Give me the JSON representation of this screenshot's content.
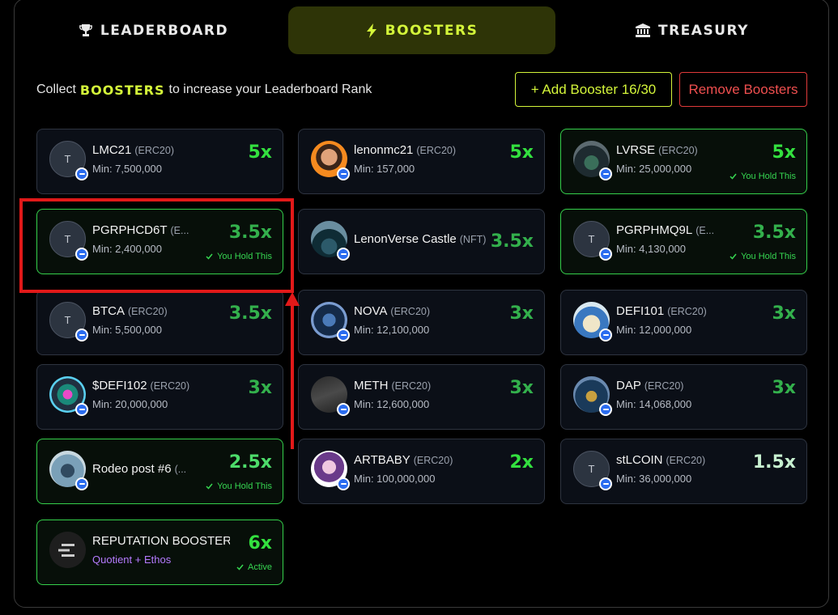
{
  "tabs": [
    {
      "label": "LEADERBOARD",
      "icon": "trophy-icon",
      "active": false
    },
    {
      "label": "BOOSTERS",
      "icon": "lightning-icon",
      "active": true
    },
    {
      "label": "TREASURY",
      "icon": "bank-icon",
      "active": false
    }
  ],
  "headline": {
    "prefix": "Collect",
    "accent": "BOOSTERS",
    "suffix": "to increase your Leaderboard Rank"
  },
  "buttons": {
    "add": "+ Add Booster 16/30",
    "remove": "Remove Boosters"
  },
  "colors": {
    "accent": "#d4f53a",
    "held_border": "#35d04b",
    "remove": "#ef4f4f",
    "annotation": "#e11919"
  },
  "boosters": [
    {
      "name": "LMC21",
      "standard": "(ERC20)",
      "min": "Min: 7,500,000",
      "multiplier": "5x",
      "held": false
    },
    {
      "name": "lenonmc21",
      "standard": "(ERC20)",
      "min": "Min: 157,000",
      "multiplier": "5x",
      "held": false
    },
    {
      "name": "LVRSE",
      "standard": "(ERC20)",
      "min": "Min: 25,000,000",
      "multiplier": "5x",
      "held": true,
      "status": "You Hold This"
    },
    {
      "name": "PGRPHCD6T",
      "standard": "(E...",
      "min": "Min: 2,400,000",
      "multiplier": "3.5x",
      "held": true,
      "status": "You Hold This"
    },
    {
      "name": "LenonVerse Castle",
      "standard": "(NFT)",
      "min": "",
      "multiplier": "3.5x",
      "held": false
    },
    {
      "name": "PGRPHMQ9L",
      "standard": "(E...",
      "min": "Min: 4,130,000",
      "multiplier": "3.5x",
      "held": true,
      "status": "You Hold This"
    },
    {
      "name": "BTCA",
      "standard": "(ERC20)",
      "min": "Min: 5,500,000",
      "multiplier": "3.5x",
      "held": false
    },
    {
      "name": "NOVA",
      "standard": "(ERC20)",
      "min": "Min: 12,100,000",
      "multiplier": "3x",
      "held": false
    },
    {
      "name": "DEFI101",
      "standard": "(ERC20)",
      "min": "Min: 12,000,000",
      "multiplier": "3x",
      "held": false
    },
    {
      "name": "$DEFI102",
      "standard": "(ERC20)",
      "min": "Min: 20,000,000",
      "multiplier": "3x",
      "held": false
    },
    {
      "name": "METH",
      "standard": "(ERC20)",
      "min": "Min: 12,600,000",
      "multiplier": "3x",
      "held": false
    },
    {
      "name": "DAP",
      "standard": "(ERC20)",
      "min": "Min: 14,068,000",
      "multiplier": "3x",
      "held": false
    },
    {
      "name": "Rodeo post #6",
      "standard": "(...",
      "min": "",
      "multiplier": "2.5x",
      "held": true,
      "status": "You Hold This"
    },
    {
      "name": "ARTBABY",
      "standard": "(ERC20)",
      "min": "Min: 100,000,000",
      "multiplier": "2x",
      "held": false
    },
    {
      "name": "stLCOIN",
      "standard": "(ERC20)",
      "min": "Min: 36,000,000",
      "multiplier": "1.5x",
      "held": false
    },
    {
      "name": "REPUTATION BOOSTER",
      "standard": "",
      "min": "Quotient + Ethos",
      "multiplier": "6x",
      "held": true,
      "status": "Active"
    }
  ],
  "avatar_letter": "T"
}
